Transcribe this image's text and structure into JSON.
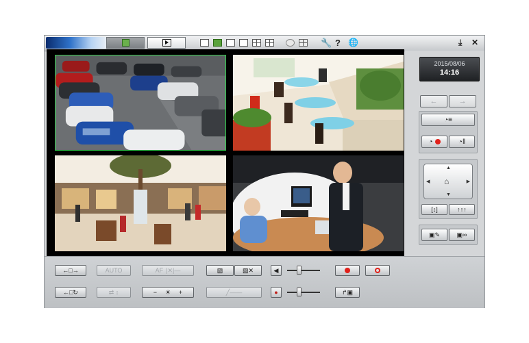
{
  "titlebar": {
    "live_icon": "live-camera-icon",
    "play_icon": "playback-icon",
    "layout_icons": [
      "layout-1-icon",
      "layout-4-icon",
      "layout-9-icon",
      "layout-16-icon",
      "layout-seq-icon",
      "layout-custom-icon"
    ],
    "tool_icons": [
      "snapshot-icon",
      "preset-icon",
      "settings-wrench-icon",
      "help-icon",
      "globe-icon",
      "download-icon",
      "close-icon"
    ],
    "help_glyph": "?",
    "close_glyph": "✕"
  },
  "clock": {
    "date": "2015/08/06",
    "time": "14:16"
  },
  "right_panel": {
    "prev_label": "←",
    "next_label": "→"
  },
  "bottom": {
    "auto_label": "AUTO",
    "af_label": "AF",
    "minus_label": "−",
    "plus_label": "+"
  },
  "colors": {
    "accent_green": "#5aa23c",
    "record_red": "#e1201a",
    "selected_border": "#2fd14b"
  },
  "volume_level": 0.35,
  "mic_level": 0.35
}
